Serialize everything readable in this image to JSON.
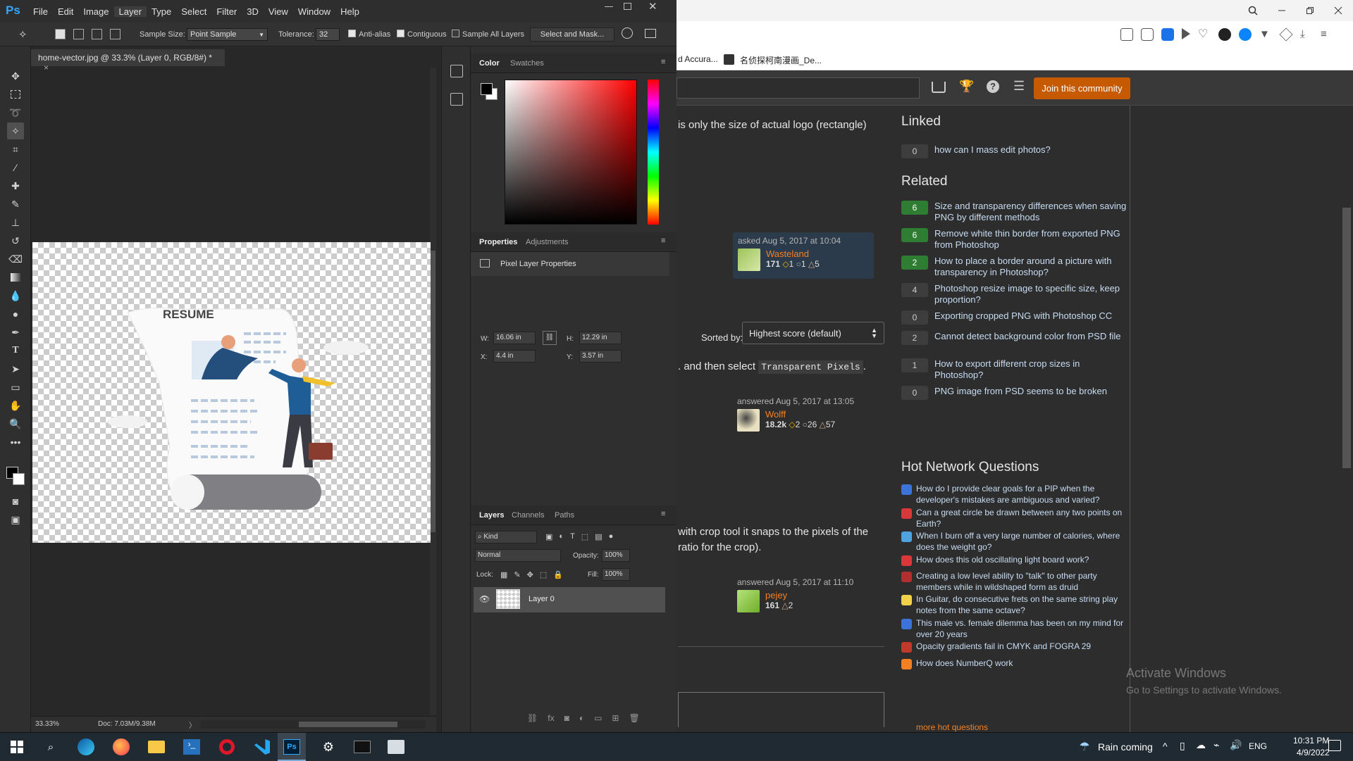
{
  "browser": {
    "bookmarks": [
      "d Accura...",
      "名侦探柯南漫画_De..."
    ],
    "site": {
      "join_button": "Join this community",
      "body_lines": {
        "logo_note": "is only the size of actual logo (rectangle)",
        "transparent_pixels_pre": ". and then select",
        "transparent_pixels_code": "Transparent Pixels",
        "transparent_pixels_post": ".",
        "crop_note_1": "with crop tool it snaps to the pixels of the",
        "crop_note_2": "ratio for the crop)."
      },
      "asked": {
        "meta": "asked Aug 5, 2017 at 10:04",
        "user": "Wasteland",
        "rep": "171",
        "gold": "1",
        "silver": "1",
        "bronze": "5"
      },
      "sort": {
        "label": "Sorted by:",
        "value": "Highest score (default)"
      },
      "answers": [
        {
          "meta": "answered Aug 5, 2017 at 13:05",
          "user": "Wolff",
          "rep": "18.2k",
          "b1": "2",
          "b2": "26",
          "b3": "57"
        },
        {
          "meta": "answered Aug 5, 2017 at 11:10",
          "user": "pejey",
          "rep": "161",
          "b1": "2"
        }
      ],
      "linked": {
        "heading": "Linked",
        "items": [
          {
            "score": "0",
            "text": "how can I mass edit photos?"
          }
        ]
      },
      "related": {
        "heading": "Related",
        "items": [
          {
            "score": "6",
            "text": "Size and transparency differences when saving PNG by different methods"
          },
          {
            "score": "6",
            "text": "Remove white thin border from exported PNG from Photoshop"
          },
          {
            "score": "2",
            "text": "How to place a border around a picture with transparency in Photoshop?"
          },
          {
            "score": "4",
            "text": "Photoshop resize image to specific size, keep proportion?"
          },
          {
            "score": "0",
            "text": "Exporting cropped PNG with Photoshop CC"
          },
          {
            "score": "2",
            "text": "Cannot detect background color from PSD file"
          },
          {
            "score": "1",
            "text": "How to export different crop sizes in Photoshop?"
          },
          {
            "score": "0",
            "text": "PNG image from PSD seems to be broken"
          }
        ]
      },
      "hot": {
        "heading": "Hot Network Questions",
        "items": [
          "How do I provide clear goals for a PIP when the developer's mistakes are ambiguous and varied?",
          "Can a great circle be drawn between any two points on Earth?",
          "When I burn off a very large number of calories, where does the weight go?",
          "How does this old oscillating light board work?",
          "Creating a low level ability to \"talk\" to other party members while in wildshaped form as druid",
          "In Guitar, do consecutive frets on the same string play notes from the same octave?",
          "This male vs. female dilemma has been on my mind for over 20 years",
          "Opacity gradients fail in CMYK and FOGRA 29",
          "How does NumberQ work"
        ],
        "more": "more hot questions"
      },
      "activate": {
        "title": "Activate Windows",
        "sub": "Go to Settings to activate Windows."
      }
    }
  },
  "photoshop": {
    "logo": "Ps",
    "menu": [
      "File",
      "Edit",
      "Image",
      "Layer",
      "Type",
      "Select",
      "Filter",
      "3D",
      "View",
      "Window",
      "Help"
    ],
    "options": {
      "sample_size_label": "Sample Size:",
      "sample_size_value": "Point Sample",
      "tolerance_label": "Tolerance:",
      "tolerance_value": "32",
      "anti_alias": "Anti-alias",
      "contiguous": "Contiguous",
      "sample_all": "Sample All Layers",
      "select_mask": "Select and Mask..."
    },
    "document": {
      "tab": "home-vector.jpg @ 33.3% (Layer 0, RGB/8#) *",
      "zoom": "33.33%",
      "doc_info": "Doc: 7.03M/9.38M",
      "artwork_text": "RESUME"
    },
    "color_panel": {
      "tabs": [
        "Color",
        "Swatches"
      ]
    },
    "properties_panel": {
      "tabs": [
        "Properties",
        "Adjustments"
      ],
      "title": "Pixel Layer Properties",
      "w_label": "W:",
      "w": "16.06 in",
      "h_label": "H:",
      "h": "12.29 in",
      "x_label": "X:",
      "x": "4.4 in",
      "y_label": "Y:",
      "y": "3.57 in"
    },
    "layers_panel": {
      "tabs": [
        "Layers",
        "Channels",
        "Paths"
      ],
      "filter": "Kind",
      "blend": "Normal",
      "opacity_label": "Opacity:",
      "opacity": "100%",
      "lock_label": "Lock:",
      "fill_label": "Fill:",
      "fill": "100%",
      "layer_name": "Layer 0"
    }
  },
  "taskbar": {
    "weather": "Rain coming",
    "lang": "ENG",
    "time": "10:31 PM",
    "date": "4/9/2022"
  }
}
